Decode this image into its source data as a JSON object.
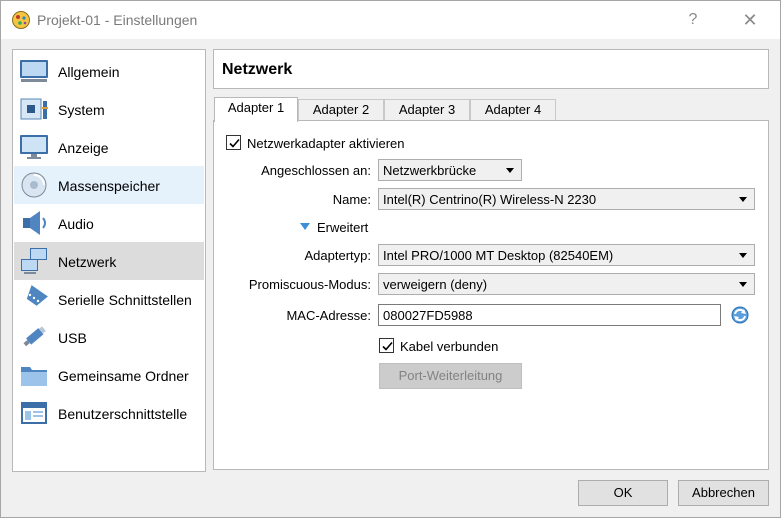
{
  "window": {
    "title": "Projekt-01 - Einstellungen",
    "help_glyph": "?",
    "close_glyph": "✕"
  },
  "sidebar": {
    "items": [
      {
        "label": "Allgemein",
        "icon": "monitor-general-icon"
      },
      {
        "label": "System",
        "icon": "system-chip-icon"
      },
      {
        "label": "Anzeige",
        "icon": "display-icon"
      },
      {
        "label": "Massenspeicher",
        "icon": "disk-storage-icon"
      },
      {
        "label": "Audio",
        "icon": "speaker-audio-icon"
      },
      {
        "label": "Netzwerk",
        "icon": "network-icon"
      },
      {
        "label": "Serielle Schnittstellen",
        "icon": "serial-port-icon"
      },
      {
        "label": "USB",
        "icon": "usb-icon"
      },
      {
        "label": "Gemeinsame Ordner",
        "icon": "shared-folder-icon"
      },
      {
        "label": "Benutzerschnittstelle",
        "icon": "user-interface-icon"
      }
    ],
    "selected": "Netzwerk"
  },
  "main": {
    "header": "Netzwerk",
    "tabs": [
      {
        "label": "Adapter 1"
      },
      {
        "label": "Adapter 2"
      },
      {
        "label": "Adapter 3"
      },
      {
        "label": "Adapter 4"
      }
    ],
    "active_tab": "Adapter 1",
    "enable_adapter": {
      "label": "Netzwerkadapter aktivieren",
      "checked": true
    },
    "attached_to": {
      "label": "Angeschlossen an:",
      "value": "Netzwerkbrücke"
    },
    "name": {
      "label": "Name:",
      "value": "Intel(R) Centrino(R) Wireless-N 2230"
    },
    "advanced": {
      "label": "Erweitert",
      "expanded": true
    },
    "adapter_type": {
      "label": "Adaptertyp:",
      "value": "Intel PRO/1000 MT Desktop (82540EM)"
    },
    "promiscuous": {
      "label": "Promiscuous-Modus:",
      "value": "verweigern (deny)"
    },
    "mac": {
      "label": "MAC-Adresse:",
      "value": "080027FD5988"
    },
    "cable": {
      "label": "Kabel verbunden",
      "checked": true
    },
    "port_forwarding": {
      "label": "Port-Weiterleitung",
      "enabled": false
    }
  },
  "footer": {
    "ok_label": "OK",
    "cancel_label": "Abbrechen"
  },
  "colors": {
    "selection": "#dcdcdc",
    "hover": "#e5f1fb",
    "accent_blue": "#3a8fd6"
  }
}
